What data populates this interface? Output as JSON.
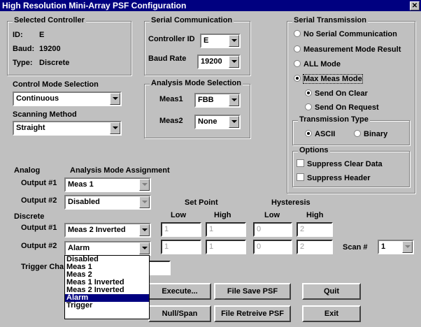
{
  "window": {
    "title": "High Resolution Mini-Array PSF Configuration"
  },
  "selected_controller": {
    "title": "Selected Controller",
    "id_label": "ID:",
    "id_value": "E",
    "baud_label": "Baud:",
    "baud_value": "19200",
    "type_label": "Type:",
    "type_value": "Discrete"
  },
  "serial_comm": {
    "title": "Serial Communication",
    "controller_id_label": "Controller ID",
    "controller_id_value": "E",
    "baud_rate_label": "Baud Rate",
    "baud_rate_value": "19200"
  },
  "serial_transmission": {
    "title": "Serial Transmission",
    "options": [
      "No Serial Communication",
      "Measurement Mode Result",
      "ALL Mode",
      "Max Meas Mode"
    ],
    "selected_index": 3,
    "send_on_clear": "Send On Clear",
    "send_on_request": "Send On Request",
    "transmission_type_title": "Transmission Type",
    "ascii": "ASCII",
    "binary": "Binary",
    "options_title": "Options",
    "suppress_clear": "Suppress Clear Data",
    "suppress_header": "Suppress Header"
  },
  "control_mode": {
    "label": "Control Mode Selection",
    "value": "Continuous"
  },
  "scanning": {
    "label": "Scanning Method",
    "value": "Straight"
  },
  "analysis_mode": {
    "title": "Analysis Mode Selection",
    "meas1_label": "Meas1",
    "meas1_value": "FBB",
    "meas2_label": "Meas2",
    "meas2_value": "None"
  },
  "analog": {
    "label": "Analog",
    "assignment_label": "Analysis Mode Assignment",
    "output1_label": "Output #1",
    "output1_value": "Meas 1",
    "output2_label": "Output #2",
    "output2_value": "Disabled"
  },
  "set_point": {
    "label": "Set Point",
    "low": "Low",
    "high": "High"
  },
  "hysteresis": {
    "label": "Hysteresis",
    "low": "Low",
    "high": "High"
  },
  "discrete": {
    "label": "Discrete",
    "output1_label": "Output #1",
    "output1_value": "Meas 2 Inverted",
    "out1_sp_low": "1",
    "out1_sp_high": "1",
    "out1_hy_low": "0",
    "out1_hy_high": "2",
    "output2_label": "Output #2",
    "output2_value": "Alarm",
    "out2_sp_low": "1",
    "out2_sp_high": "1",
    "out2_hy_low": "0",
    "out2_hy_high": "2",
    "scan_label": "Scan #",
    "scan_value": "1"
  },
  "trigger": {
    "label": "Trigger Cha"
  },
  "dropdown_items": [
    "Disabled",
    "Meas 1",
    "Meas 2",
    "Meas 1 Inverted",
    "Meas 2 Inverted",
    "Alarm",
    "Trigger"
  ],
  "dropdown_selected_index": 5,
  "buttons": {
    "execute": "Execute...",
    "file_save": "File Save PSF",
    "quit": "Quit",
    "null_span": "Null/Span",
    "file_retrieve": "File Retreive PSF",
    "exit": "Exit"
  }
}
